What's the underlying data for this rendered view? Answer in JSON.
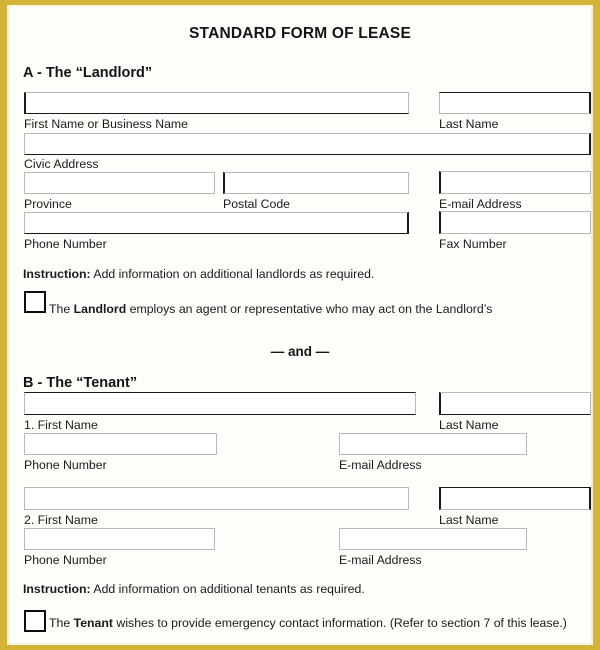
{
  "document": {
    "title": "STANDARD FORM OF LEASE",
    "frame_color": "#d4b437",
    "page_background": "#fdfdfa",
    "text_color": "#1b1b1b"
  },
  "section_a": {
    "heading": "A - The “Landlord”",
    "fields": [
      {
        "label": "First Name or Business Name",
        "value": ""
      },
      {
        "label": "Last Name",
        "value": ""
      },
      {
        "label": "Civic Address",
        "value": ""
      },
      {
        "label": "Province",
        "value": ""
      },
      {
        "label": "Postal Code",
        "value": ""
      },
      {
        "label": "E-mail Address",
        "value": ""
      },
      {
        "label": "Phone Number",
        "value": ""
      },
      {
        "label": "Fax Number",
        "value": ""
      }
    ],
    "instruction_prefix": "Instruction:",
    "instruction_text": " Add information on additional landlords as required.",
    "checkbox": {
      "checked": false,
      "text_before": "The ",
      "text_bold": "Landlord",
      "text_after": " employs an agent or representative who may act on the Landlord’s"
    }
  },
  "separator": {
    "text": "— and —"
  },
  "section_b": {
    "heading": "B - The “Tenant”",
    "tenant_1": [
      {
        "label": "1. First Name",
        "value": ""
      },
      {
        "label": "Last Name",
        "value": ""
      },
      {
        "label": "Phone Number",
        "value": ""
      },
      {
        "label": "E-mail Address",
        "value": ""
      }
    ],
    "tenant_2": [
      {
        "label": "2. First Name",
        "value": ""
      },
      {
        "label": "Last Name",
        "value": ""
      },
      {
        "label": "Phone Number",
        "value": ""
      },
      {
        "label": "E-mail Address",
        "value": ""
      }
    ],
    "instruction_prefix": "Instruction:",
    "instruction_text": " Add information on additional tenants as required.",
    "checkbox": {
      "checked": false,
      "text_before": "The ",
      "text_bold": "Tenant",
      "text_after": " wishes to provide emergency contact information. (Refer to section 7 of this lease.)"
    }
  }
}
